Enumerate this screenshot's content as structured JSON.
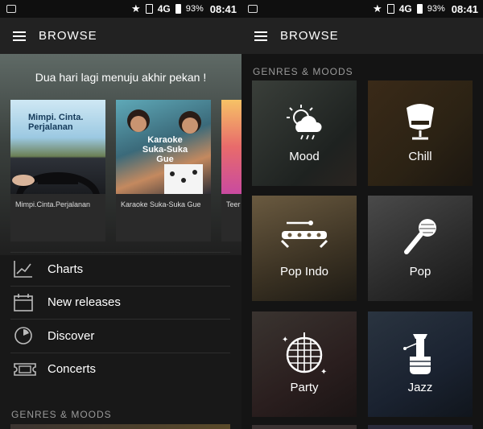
{
  "status_bar": {
    "network": "4G",
    "battery": "93%",
    "time": "08:41"
  },
  "app_bar": {
    "title": "BROWSE"
  },
  "browse": {
    "hero_caption": "Dua hari lagi menuju akhir pekan !",
    "cards": [
      {
        "art_text": "Mimpi. Cinta. Perjalanan",
        "label": "Mimpi.Cinta.Perjalanan"
      },
      {
        "art_text": "Karaoke Suka-Suka Gue",
        "label": "Karaoke Suka-Suka Gue"
      },
      {
        "art_text": "",
        "label": "Teer"
      }
    ],
    "menu": [
      {
        "label": "Charts",
        "icon": "chart-line-icon"
      },
      {
        "label": "New releases",
        "icon": "calendar-icon"
      },
      {
        "label": "Discover",
        "icon": "discover-icon"
      },
      {
        "label": "Concerts",
        "icon": "ticket-icon"
      }
    ],
    "section_title": "GENRES & MOODS"
  },
  "genres": {
    "section_title": "GENRES & MOODS",
    "tiles": [
      {
        "label": "Mood",
        "icon": "weather-sun-cloud-icon"
      },
      {
        "label": "Chill",
        "icon": "egg-chair-icon"
      },
      {
        "label": "Pop Indo",
        "icon": "kulintang-icon"
      },
      {
        "label": "Pop",
        "icon": "microphone-icon"
      },
      {
        "label": "Party",
        "icon": "disco-ball-icon"
      },
      {
        "label": "Jazz",
        "icon": "saxophone-icon"
      }
    ]
  }
}
